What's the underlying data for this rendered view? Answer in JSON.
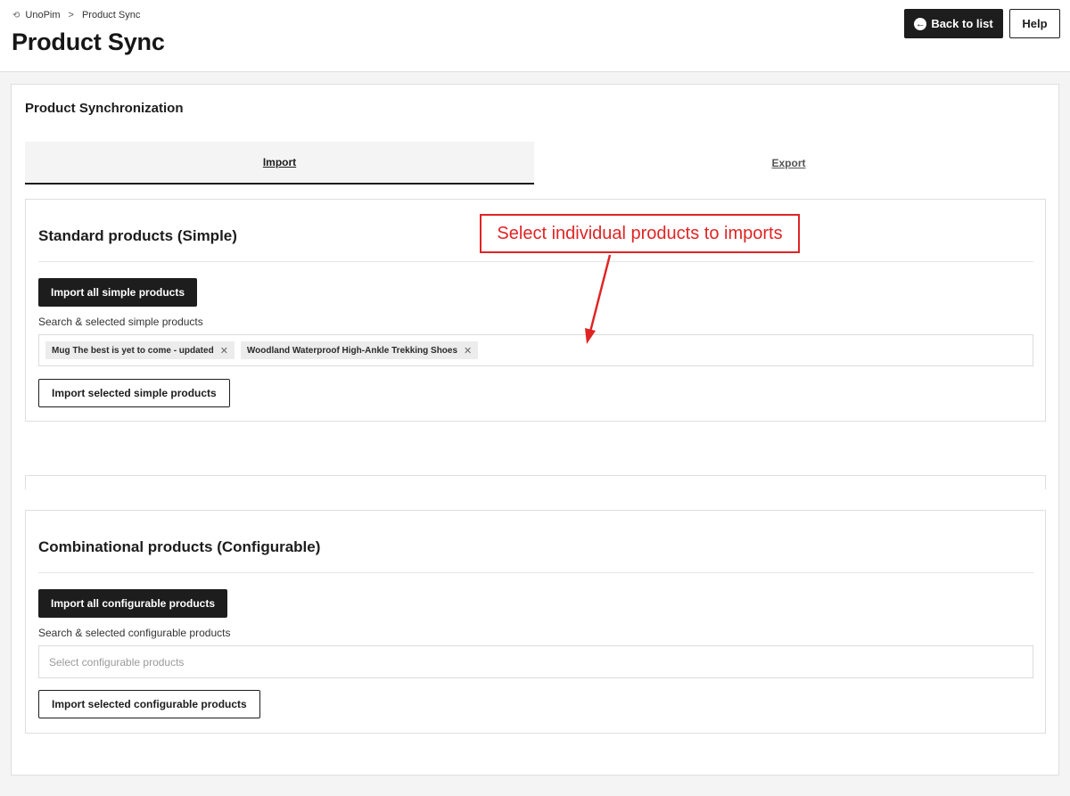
{
  "breadcrumb": {
    "root": "UnoPim",
    "separator": ">",
    "current": "Product Sync",
    "root_icon": "sync-icon"
  },
  "header": {
    "title": "Product Sync",
    "back_label": "Back to list",
    "help_label": "Help"
  },
  "main": {
    "heading": "Product Synchronization",
    "tabs": [
      {
        "label": "Import",
        "active": true
      },
      {
        "label": "Export",
        "active": false
      }
    ]
  },
  "simple": {
    "title": "Standard products (Simple)",
    "import_all_label": "Import all simple products",
    "search_label": "Search & selected simple products",
    "selected": [
      {
        "label": "Mug The best is yet to come - updated"
      },
      {
        "label": "Woodland Waterproof High-Ankle Trekking Shoes"
      }
    ],
    "remove_glyph": "✕",
    "import_selected_label": "Import selected simple products"
  },
  "configurable": {
    "title": "Combinational products (Configurable)",
    "import_all_label": "Import all configurable products",
    "search_label": "Search & selected configurable products",
    "placeholder": "Select configurable products",
    "import_selected_label": "Import selected configurable products"
  },
  "annotation": {
    "text": "Select individual products to imports",
    "color": "#e02424"
  }
}
